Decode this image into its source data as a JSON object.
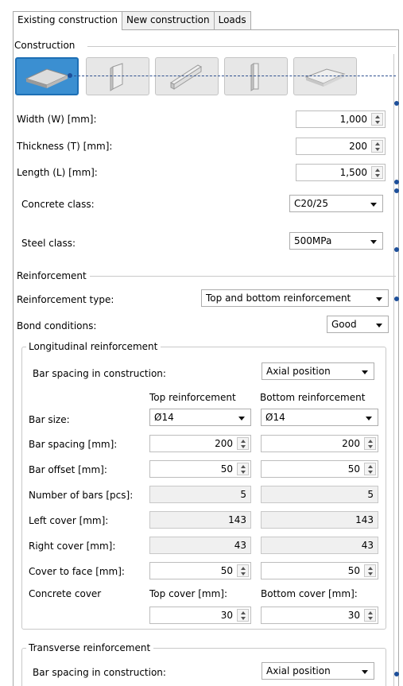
{
  "tabs": [
    "Existing construction",
    "New construction",
    "Loads"
  ],
  "groups": {
    "construction": "Construction",
    "reinforcement": "Reinforcement",
    "longitudinal": "Longitudinal reinforcement",
    "transverse": "Transverse reinforcement"
  },
  "shapes": [
    {
      "icon": "slab-horizontal-icon",
      "selected": true
    },
    {
      "icon": "wall-panel-icon",
      "selected": false
    },
    {
      "icon": "wall-diagonal-icon",
      "selected": false
    },
    {
      "icon": "column-icon",
      "selected": false
    },
    {
      "icon": "slab-inclined-icon",
      "selected": false
    }
  ],
  "dimensions": {
    "width_label": "Width (W) [mm]:",
    "width_value": "1,000",
    "thickness_label": "Thickness (T) [mm]:",
    "thickness_value": "200",
    "length_label": "Length (L) [mm]:",
    "length_value": "1,500"
  },
  "materials": {
    "concrete_label": "Concrete class:",
    "concrete_value": "C20/25",
    "steel_label": "Steel class:",
    "steel_value": "500MPa"
  },
  "reinforcement": {
    "type_label": "Reinforcement type:",
    "type_value": "Top and bottom reinforcement",
    "bond_label": "Bond conditions:",
    "bond_value": "Good"
  },
  "longitudinal": {
    "spacing_in_label": "Bar spacing in construction:",
    "spacing_in_value": "Axial position",
    "col_top": "Top reinforcement",
    "col_bottom": "Bottom reinforcement",
    "bar_size_label": "Bar size:",
    "bar_size_top": "Ø14",
    "bar_size_bottom": "Ø14",
    "bar_spacing_label": "Bar spacing [mm]:",
    "bar_spacing_top": "200",
    "bar_spacing_bottom": "200",
    "bar_offset_label": "Bar offset [mm]:",
    "bar_offset_top": "50",
    "bar_offset_bottom": "50",
    "num_bars_label": "Number of bars [pcs]:",
    "num_bars_top": "5",
    "num_bars_bottom": "5",
    "left_cover_label": "Left cover [mm]:",
    "left_cover_top": "143",
    "left_cover_bottom": "143",
    "right_cover_label": "Right cover [mm]:",
    "right_cover_top": "43",
    "right_cover_bottom": "43",
    "cover_face_label": "Cover to face [mm]:",
    "cover_face_top": "50",
    "cover_face_bottom": "50",
    "concrete_cover_label": "Concrete cover",
    "top_cover_label": "Top cover [mm]:",
    "bottom_cover_label": "Bottom cover [mm]:",
    "top_cover_value": "30",
    "bottom_cover_value": "30"
  },
  "transverse": {
    "spacing_in_label": "Bar spacing in construction:",
    "spacing_in_value": "Axial position"
  },
  "colors": {
    "accent": "#3b8fd1",
    "guide": "#1d4f9a"
  }
}
